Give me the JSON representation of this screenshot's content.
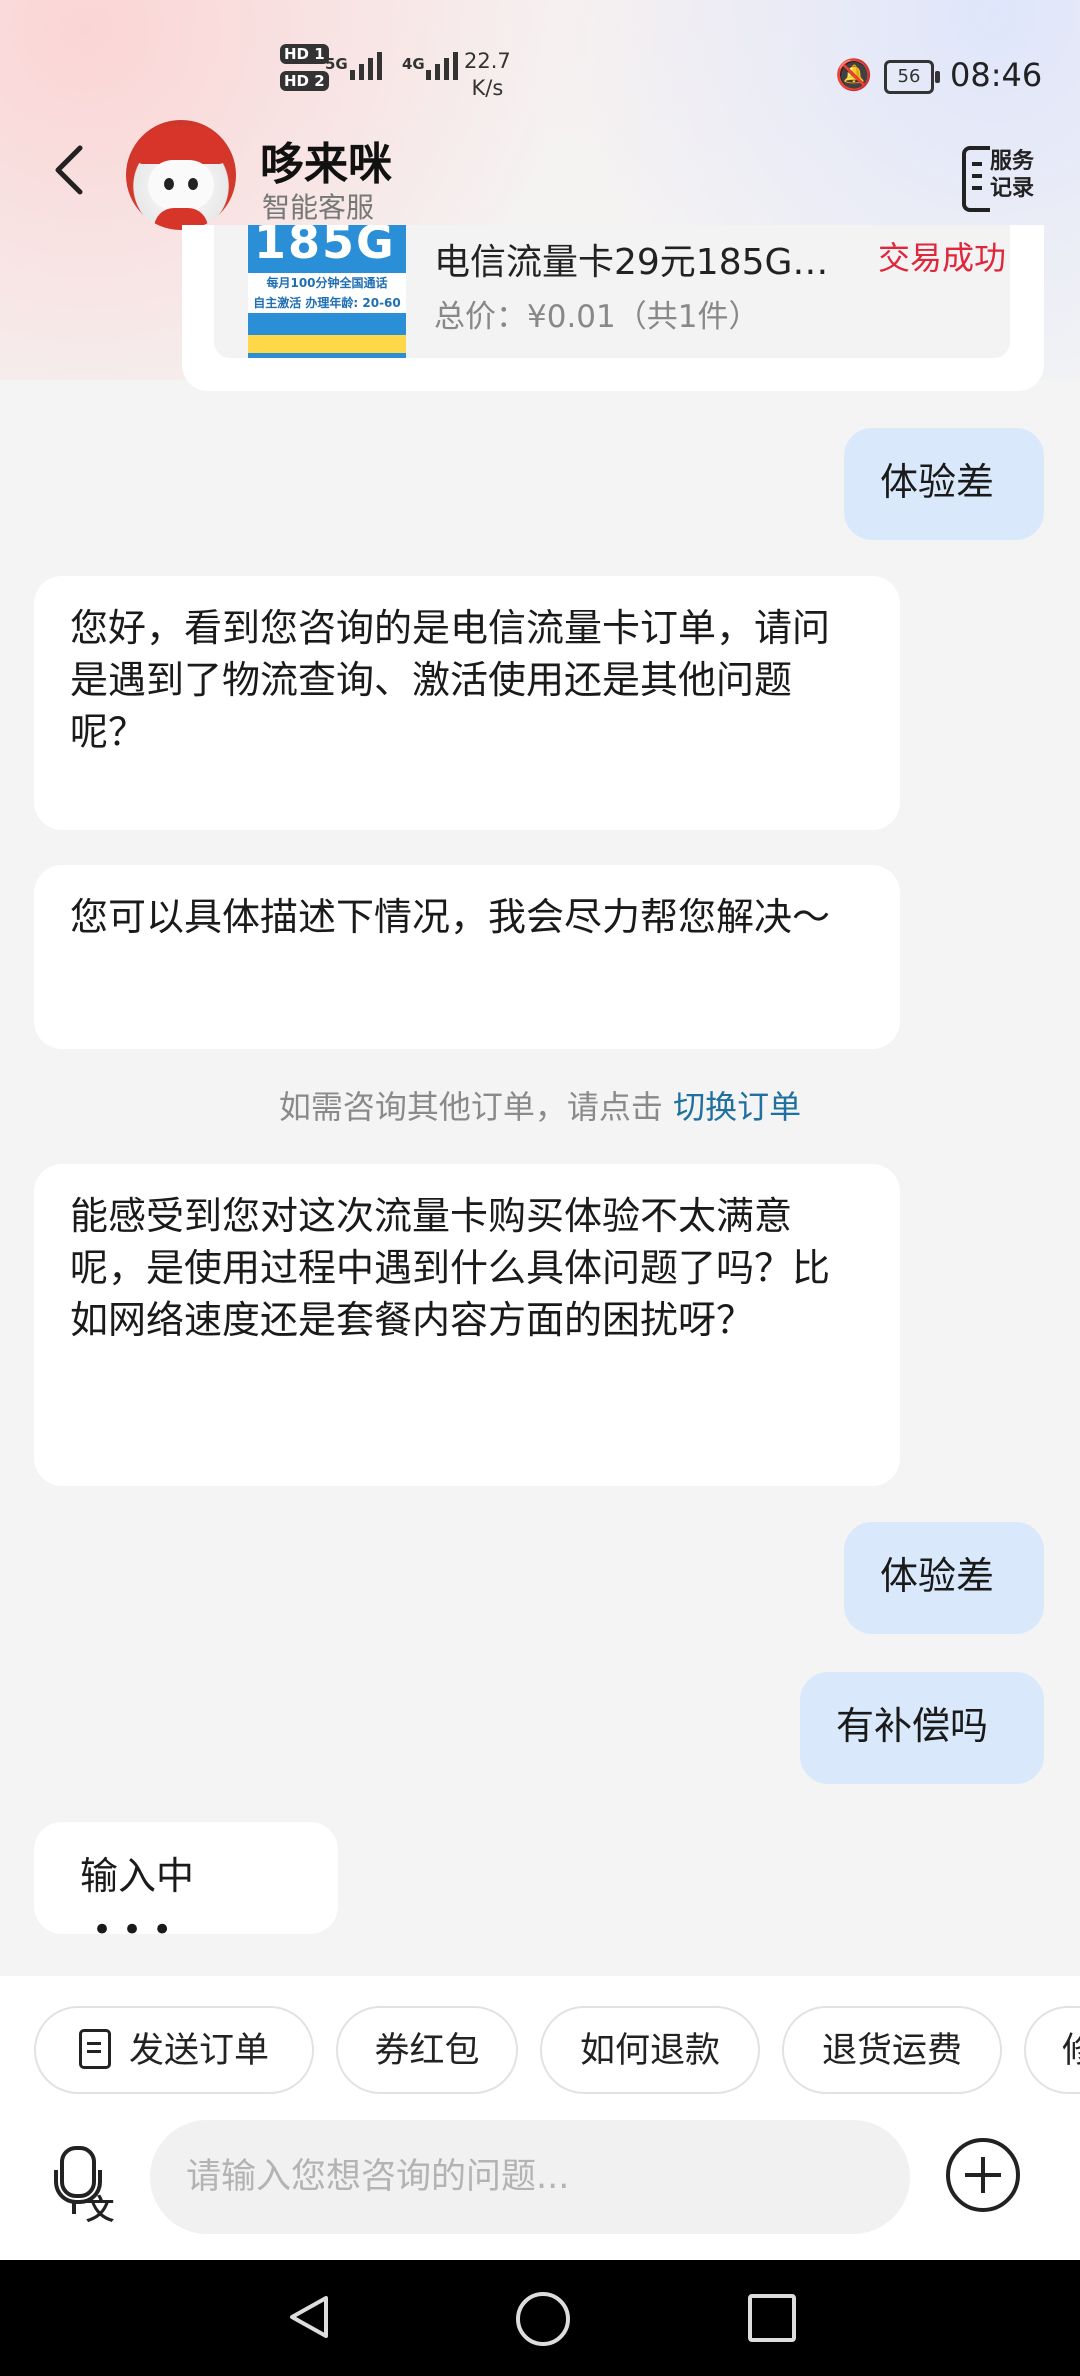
{
  "status_bar": {
    "sim1": "HD 1",
    "sim2": "HD 2",
    "net1": "5G",
    "net2": "4G",
    "speed_value": "22.7",
    "speed_unit": "K/s",
    "battery": "56",
    "time": "08:46"
  },
  "header": {
    "title": "哆来咪",
    "subtitle": "智能客服",
    "service_record_label": "服务\n记录"
  },
  "order_card": {
    "thumb_big": "185G",
    "thumb_line1": "每月100分钟全国通话",
    "thumb_line2": "自主激活 办理年龄: 20-60",
    "product_title": "电信流量卡29元185G…",
    "status": "交易成功",
    "price_text": "总价：¥0.01（共1件）"
  },
  "messages": [
    {
      "sender": "user",
      "text": "体验差"
    },
    {
      "sender": "bot",
      "text": "您好，看到您咨询的是电信流量卡订单，请问是遇到了物流查询、激活使用还是其他问题呢？"
    },
    {
      "sender": "bot",
      "text": "您可以具体描述下情况，我会尽力帮您解决～"
    },
    {
      "sender": "bot",
      "text": "能感受到您对这次流量卡购买体验不太满意呢，是使用过程中遇到什么具体问题了吗？比如网络速度还是套餐内容方面的困扰呀？"
    },
    {
      "sender": "user",
      "text": "体验差"
    },
    {
      "sender": "user",
      "text": "有补偿吗"
    },
    {
      "sender": "bot",
      "text": "输入中"
    }
  ],
  "typing_dots": "•••",
  "notice": {
    "text": "如需咨询其他订单，请点击",
    "link": "切换订单"
  },
  "quick_actions": [
    "发送订单",
    "券红包",
    "如何退款",
    "退货运费",
    "修"
  ],
  "input": {
    "placeholder": "请输入您想咨询的问题...",
    "voice_label": "文"
  }
}
